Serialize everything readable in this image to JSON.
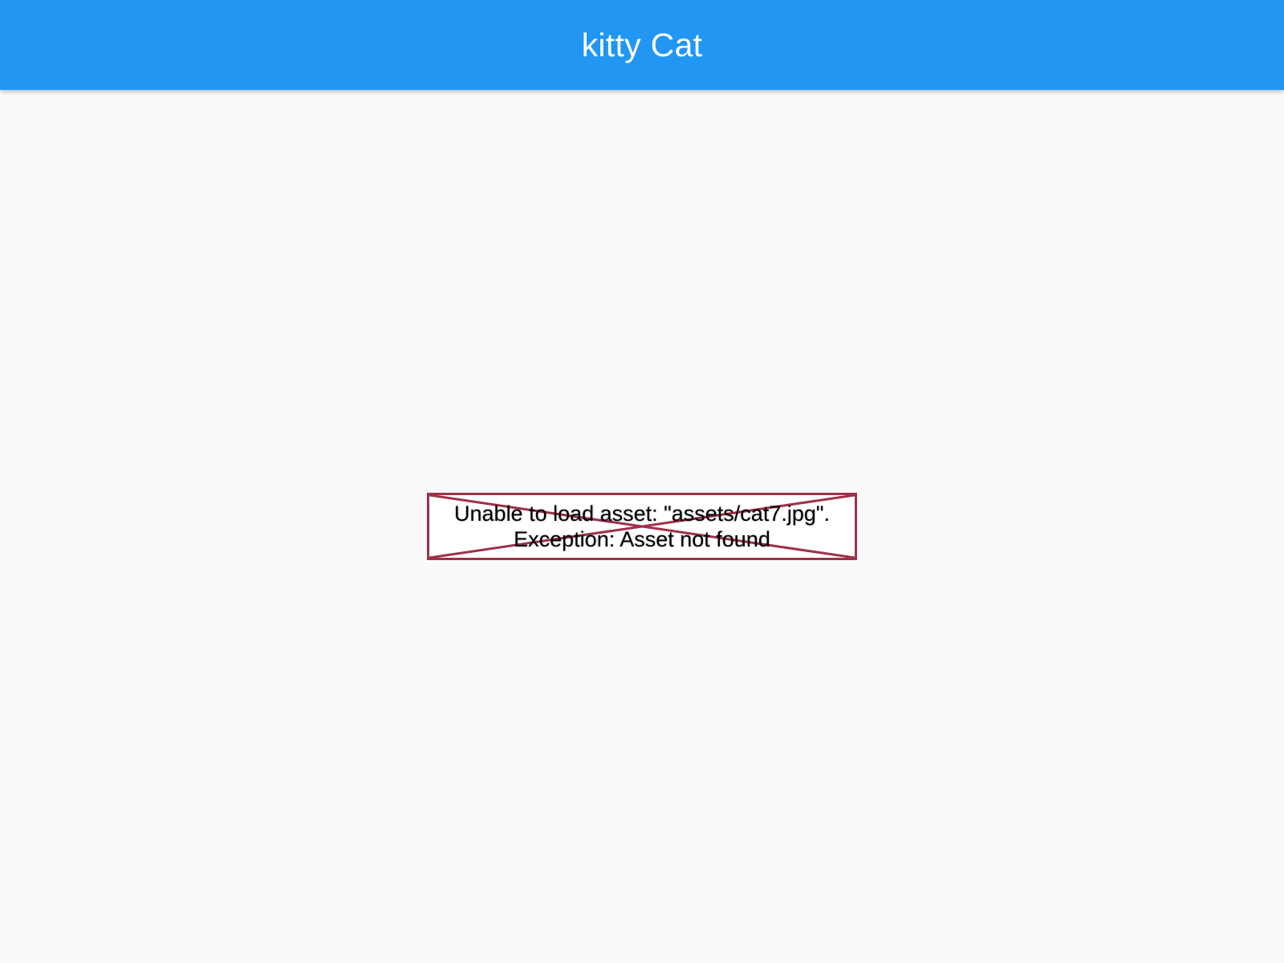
{
  "app_bar": {
    "title": "kitty Cat",
    "color": "#2196f3",
    "title_color": "#ffffff"
  },
  "error_image": {
    "line1": "Unable to load asset: \"assets/cat7.jpg\".",
    "line2": "Exception: Asset not found",
    "border_color": "#a0304a",
    "icon": "broken-image-cross-icon"
  },
  "background_color": "#fafafa"
}
